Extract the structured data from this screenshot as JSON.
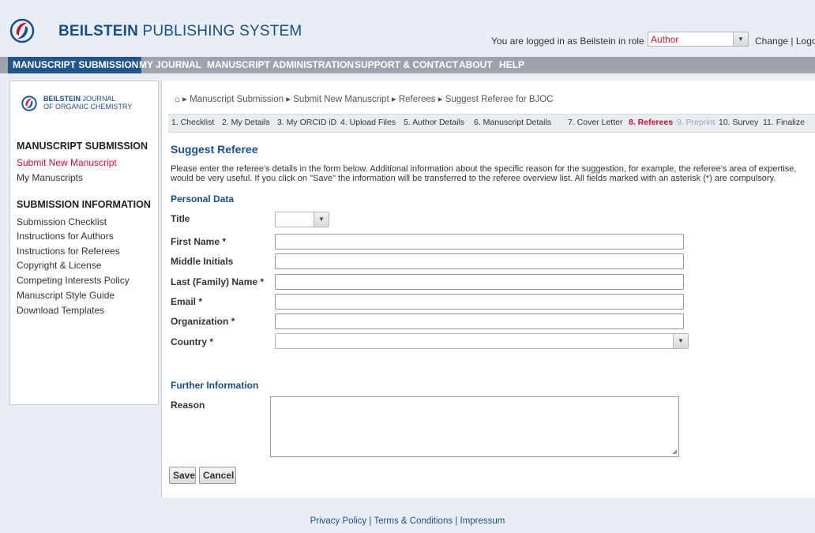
{
  "header": {
    "brand_bold": "BEILSTEIN",
    "brand_rest": " PUBLISHING SYSTEM",
    "login_text": "You are logged in as Beilstein in role",
    "role_value": "Author",
    "change_link": "Change",
    "separator": "|",
    "logout_link": "Logout"
  },
  "topnav": {
    "items": [
      "MANUSCRIPT SUBMISSION",
      "MY JOURNAL",
      "MANUSCRIPT ADMINISTRATION",
      "SUPPORT & CONTACT",
      "ABOUT",
      "HELP"
    ]
  },
  "sidebar": {
    "journal_bold": "BEILSTEIN",
    "journal_line1_rest": " JOURNAL",
    "journal_line2": "OF ORGANIC CHEMISTRY",
    "submission_heading": "MANUSCRIPT SUBMISSION",
    "submission_links": [
      "Submit New Manuscript",
      "My Manuscripts"
    ],
    "info_heading": "SUBMISSION INFORMATION",
    "info_links": [
      "Submission Checklist",
      "Instructions for Authors",
      "Instructions for Referees",
      "Copyright & License",
      "Competing Interests Policy",
      "Manuscript Style Guide",
      "Download Templates"
    ]
  },
  "breadcrumb": {
    "home_icon": "⌂",
    "sep": "▸",
    "items": [
      "Manuscript Submission",
      "Submit New Manuscript",
      "Referees",
      "Suggest Referee for BJOC"
    ]
  },
  "steps": [
    "1. Checklist",
    "2. My Details",
    "3. My ORCID iD",
    "4. Upload Files",
    "5. Author Details",
    "6. Manuscript Details",
    "7. Cover Letter",
    "8. Referees",
    "9. Preprint",
    "10. Survey",
    "11. Finalize"
  ],
  "form": {
    "title": "Suggest Referee",
    "intro": "Please enter the referee's details in the form below. Additional information about the specific reason for the suggestion, for example, the referee's area of expertise, would be very useful. If you click on \"Save\" the information will be transferred to the referee overview list. All fields marked with an asterisk (*) are compulsory.",
    "personal_heading": "Personal Data",
    "labels": {
      "title": "Title",
      "first_name": "First Name *",
      "middle_initials": "Middle Initials",
      "last_name": "Last (Family) Name *",
      "email": "Email *",
      "organization": "Organization *",
      "country": "Country *"
    },
    "values": {
      "title": "",
      "first_name": "",
      "middle_initials": "",
      "last_name": "",
      "email": "",
      "organization": "",
      "country": ""
    },
    "further_heading": "Further Information",
    "reason_label": "Reason",
    "reason_value": "",
    "save_label": "Save",
    "cancel_label": "Cancel"
  },
  "footer": {
    "privacy": "Privacy Policy",
    "terms": "Terms & Conditions",
    "impressum": "Impressum",
    "sep": "|"
  },
  "colors": {
    "brand_blue": "#1a4f86",
    "accent_red": "#c8102e",
    "nav_gray": "#9ea4a9",
    "nav_active": "#22558b"
  }
}
